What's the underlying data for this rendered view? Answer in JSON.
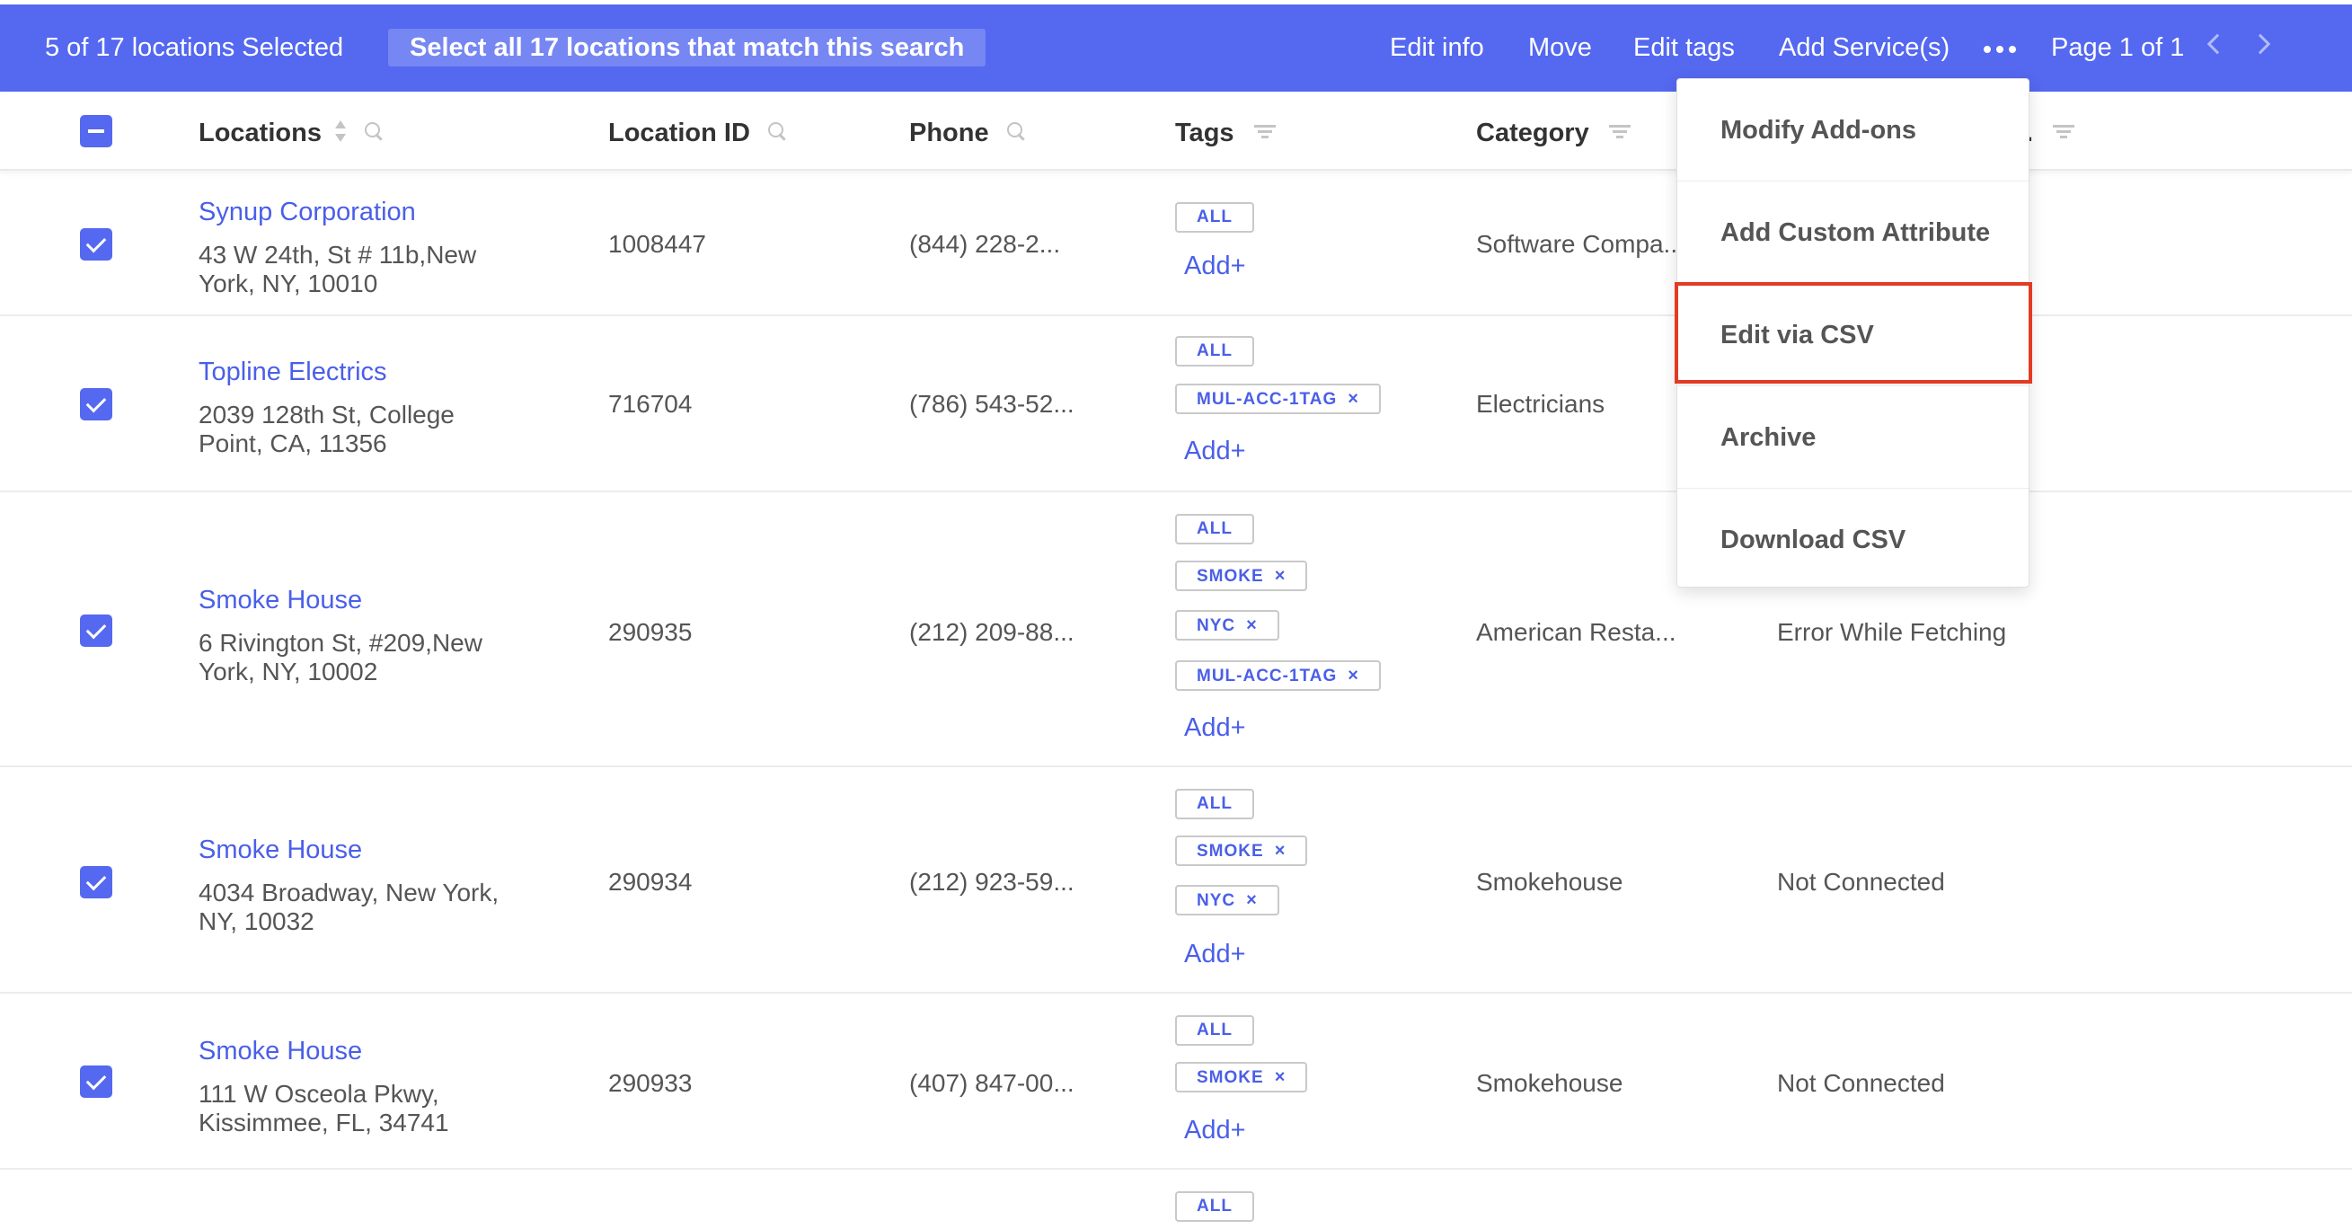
{
  "topbar": {
    "selection_count": "5 of 17 locations Selected",
    "select_all_label": "Select all 17 locations that match this search",
    "actions": [
      "Edit info",
      "Move",
      "Edit tags",
      "Add Service(s)"
    ],
    "pagination": "Page 1 of 1",
    "colors": {
      "bar": "#5468f0"
    }
  },
  "columns": {
    "locations": "Locations",
    "location_id": "Location ID",
    "phone": "Phone",
    "tags": "Tags",
    "category": "Category",
    "truncated": "."
  },
  "add_label": "Add+",
  "rows": [
    {
      "name": "Synup Corporation",
      "address_line1": "43 W 24th, St # 11b,New",
      "address_line2": "York, NY, 10010",
      "location_id": "1008447",
      "phone": "(844) 228-2...",
      "tags": [
        "ALL"
      ],
      "category": "Software Compa...",
      "status": ""
    },
    {
      "name": "Topline Electrics",
      "address_line1": "2039 128th St, College",
      "address_line2": "Point, CA, 11356",
      "location_id": "716704",
      "phone": "(786) 543-52...",
      "tags": [
        "ALL",
        "MUL-ACC-1TAG"
      ],
      "category": "Electricians",
      "status": ""
    },
    {
      "name": "Smoke House",
      "address_line1": "6 Rivington St, #209,New",
      "address_line2": "York, NY, 10002",
      "location_id": "290935",
      "phone": "(212) 209-88...",
      "tags": [
        "ALL",
        "SMOKE",
        "NYC",
        "MUL-ACC-1TAG"
      ],
      "category": "American Resta...",
      "status": "Error While Fetching"
    },
    {
      "name": "Smoke House",
      "address_line1": "4034 Broadway, New York,",
      "address_line2": "NY, 10032",
      "location_id": "290934",
      "phone": "(212) 923-59...",
      "tags": [
        "ALL",
        "SMOKE",
        "NYC"
      ],
      "category": "Smokehouse",
      "status": "Not Connected"
    },
    {
      "name": "Smoke House",
      "address_line1": "111 W Osceola Pkwy,",
      "address_line2": "Kissimmee, FL, 34741",
      "location_id": "290933",
      "phone": "(407) 847-00...",
      "tags": [
        "ALL",
        "SMOKE"
      ],
      "category": "Smokehouse",
      "status": "Not Connected"
    },
    {
      "tags": [
        "ALL"
      ]
    }
  ],
  "dropdown": {
    "items": [
      "Modify Add-ons",
      "Add Custom Attribute",
      "Edit via CSV",
      "Archive",
      "Download CSV"
    ],
    "highlighted": "Edit via CSV",
    "highlight_color": "#e23a23"
  }
}
